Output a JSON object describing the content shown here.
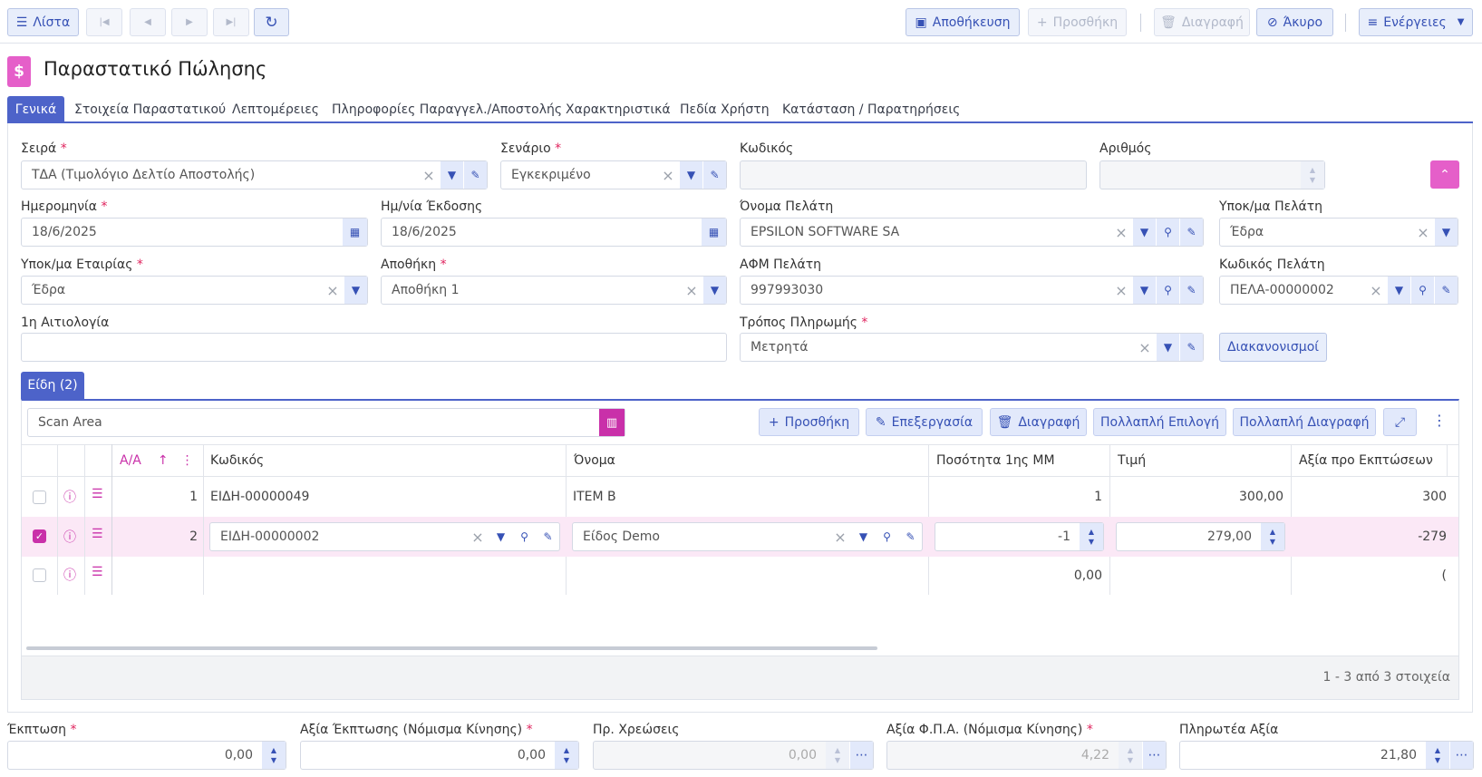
{
  "toolbar": {
    "list_label": "Λίστα",
    "save_label": "Αποθήκευση",
    "add_label": "Προσθήκη",
    "delete_label": "Διαγραφή",
    "cancel_label": "Άκυρο",
    "actions_label": "Ενέργειες"
  },
  "page": {
    "title": "Παραστατικό Πώλησης"
  },
  "tabs": [
    "Γενικά",
    "Στοιχεία Παραστατικού",
    "Λεπτομέρειες",
    "Πληροφορίες Παραγγελ./Αποστολής",
    "Χαρακτηριστικά",
    "Πεδία Χρήστη",
    "Κατάσταση / Παρατηρήσεις"
  ],
  "form": {
    "series": {
      "label": "Σειρά",
      "value": "ΤΔΑ (Τιμολόγιο Δελτίο Αποστολής)"
    },
    "scenario": {
      "label": "Σενάριο",
      "value": "Εγκεκριμένο"
    },
    "code": {
      "label": "Κωδικός",
      "value": ""
    },
    "number": {
      "label": "Αριθμός",
      "value": ""
    },
    "date": {
      "label": "Ημερομηνία",
      "value": "18/6/2025"
    },
    "issue_date": {
      "label": "Ημ/νία Έκδοσης",
      "value": "18/6/2025"
    },
    "customer_name": {
      "label": "Όνομα Πελάτη",
      "value": "EPSILON SOFTWARE SA"
    },
    "customer_branch": {
      "label": "Υποκ/μα Πελάτη",
      "value": "Έδρα"
    },
    "company_branch": {
      "label": "Υποκ/μα Εταιρίας",
      "value": "Έδρα"
    },
    "warehouse": {
      "label": "Αποθήκη",
      "value": "Αποθήκη 1"
    },
    "customer_vat": {
      "label": "ΑΦΜ Πελάτη",
      "value": "997993030"
    },
    "customer_code": {
      "label": "Κωδικός Πελάτη",
      "value": "ΠΕΛΑ-00000002"
    },
    "reason": {
      "label": "1η Αιτιολογία",
      "value": ""
    },
    "payment": {
      "label": "Τρόπος Πληρωμής",
      "value": "Μετρητά"
    },
    "settlements_label": "Διακανονισμοί"
  },
  "items": {
    "tab_label": "Είδη (2)",
    "scan_placeholder": "Scan Area",
    "add_label": "Προσθήκη",
    "edit_label": "Επεξεργασία",
    "delete_label": "Διαγραφή",
    "multi_select_label": "Πολλαπλή Επιλογή",
    "multi_delete_label": "Πολλαπλή Διαγραφή",
    "columns": {
      "aa": "Α/Α",
      "code": "Κωδικός",
      "name": "Όνομα",
      "qty": "Ποσότητα 1ης ΜΜ",
      "price": "Τιμή",
      "value": "Αξία προ Εκπτώσεων"
    },
    "rows": [
      {
        "aa": "1",
        "code": "ΕΙΔΗ-00000049",
        "name": "ITEM B",
        "qty": "1",
        "price": "300,00",
        "value": "300"
      },
      {
        "aa": "2",
        "code": "ΕΙΔΗ-00000002",
        "name": "Είδος Demo",
        "qty": "-1",
        "price": "279,00",
        "value": "-279"
      },
      {
        "aa": "",
        "code": "",
        "name": "",
        "qty": "0,00",
        "price": "",
        "value": "("
      }
    ],
    "pager": "1 - 3 από 3 στοιχεία"
  },
  "totals": {
    "discount": {
      "label": "Έκπτωση",
      "value": "0,00"
    },
    "discount_value": {
      "label": "Αξία Έκπτωσης (Νόμισμα Κίνησης)",
      "value": "0,00"
    },
    "charges": {
      "label": "Πρ. Χρεώσεις",
      "value": "0,00"
    },
    "vat_value": {
      "label": "Αξία Φ.Π.Α. (Νόμισμα Κίνησης)",
      "value": "4,22"
    },
    "payable": {
      "label": "Πληρωτέα Αξία",
      "value": "21,80"
    }
  },
  "colors": {
    "accent": "#4d63c9",
    "pink": "#c930a9"
  }
}
